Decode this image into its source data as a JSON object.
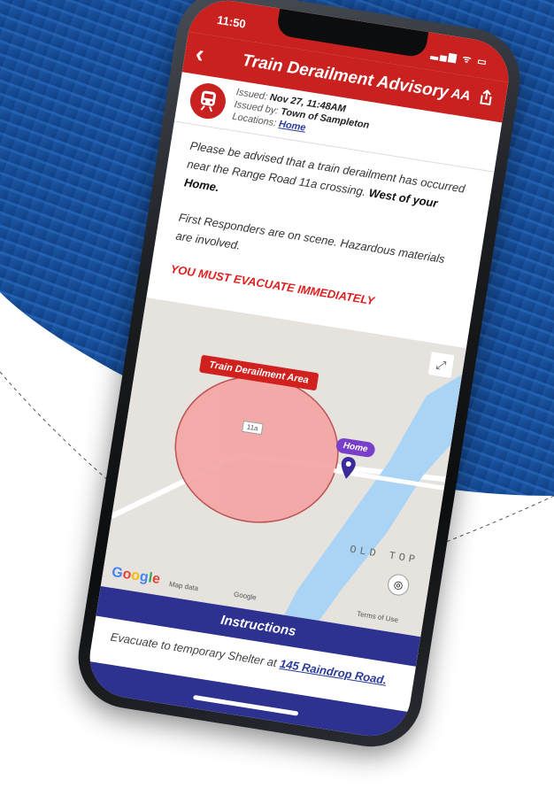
{
  "status_bar": {
    "time": "11:50",
    "icons": "▂▄▆ ᯤ ▭"
  },
  "header": {
    "back_label": "‹",
    "title": "Train Derailment Advisory",
    "text_size_label": "AA",
    "share_icon": "share-icon"
  },
  "meta": {
    "issued_label": "Issued:",
    "issued_value": "Nov 27, 11:48AM",
    "issued_by_label": "Issued by:",
    "issued_by_value": "Town of Sampleton",
    "locations_label": "Locations:",
    "locations_value": "Home"
  },
  "message": {
    "p1": "Please be advised that a train derailment has occurred near the Range Road 11a crossing.",
    "p1_bold": "West of your Home.",
    "p2": "First Responders are on scene. Hazardous materials are involved.",
    "warning": "YOU MUST EVACUATE IMMEDIATELY"
  },
  "map": {
    "area_label": "Train Derailment Area",
    "home_label": "Home",
    "road_tag": "11a",
    "place_label": "OLD TOP",
    "google": "Google",
    "map_data": "Map data",
    "google_small": "Google",
    "terms": "Terms of Use",
    "colors": {
      "area_fill": "#f4a3a3",
      "river": "#a9d4f5",
      "land": "#e6e3df"
    }
  },
  "instructions": {
    "title": "Instructions",
    "text": "Evacuate to temporary Shelter at",
    "link": "145 Raindrop Road."
  },
  "colors": {
    "primary_red": "#c8211f",
    "navy": "#2d3190",
    "link_blue": "#2a3b9a",
    "warning_red": "#e02020"
  }
}
